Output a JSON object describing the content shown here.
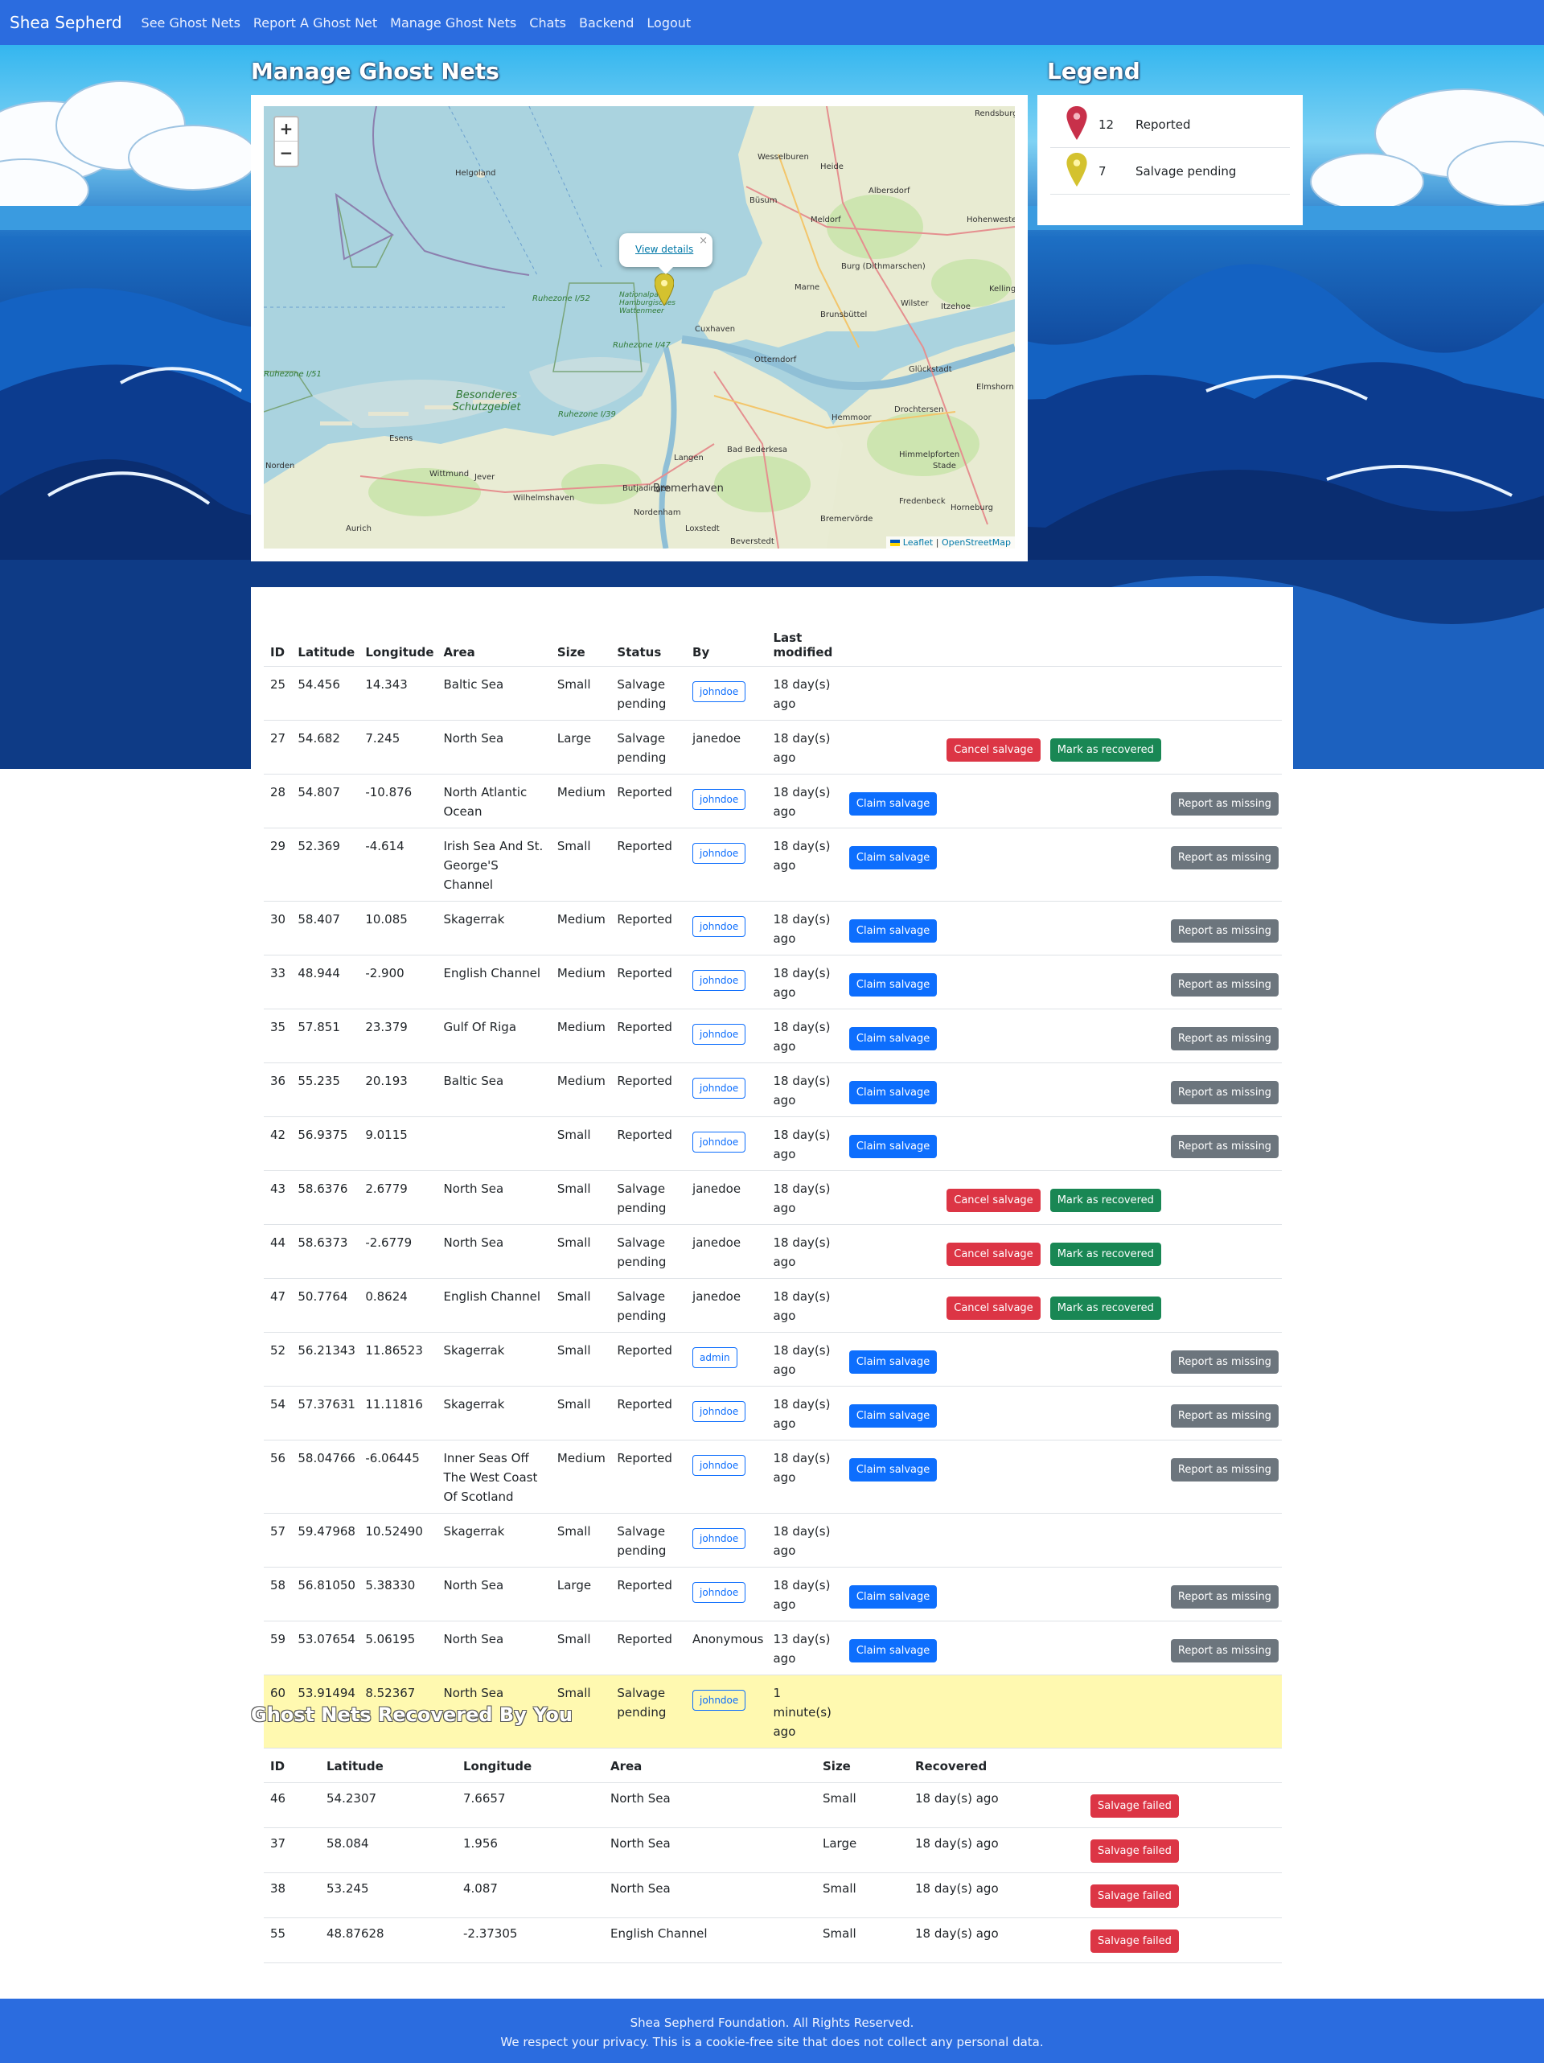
{
  "navbar": {
    "brand": "Shea Sepherd",
    "links": [
      "See Ghost Nets",
      "Report A Ghost Net",
      "Manage Ghost Nets",
      "Chats",
      "Backend",
      "Logout"
    ]
  },
  "page_title": "Manage Ghost Nets",
  "map": {
    "zoom_in": "+",
    "zoom_out": "−",
    "popup_link": "View details",
    "popup_close": "×",
    "attribution_leaflet": "Leaflet",
    "attribution_sep": "|",
    "attribution_osm": "OpenStreetMap",
    "labels": [
      "Helgoland",
      "Rendsburg",
      "Wesselburen",
      "Heide",
      "Büsum",
      "Albersdorf",
      "Meldorf",
      "Hohenwestedt",
      "Burg (Dithmarschen)",
      "Marne",
      "Wilster",
      "Itzehoe",
      "Kellinghusen",
      "Brunsbüttel",
      "Cuxhaven",
      "Otterndorf",
      "Glückstadt",
      "Elmshorn",
      "Besonderes Schutzgebiet",
      "Esens",
      "Wittmund",
      "Jever",
      "Norden",
      "Wilhelmshaven",
      "Butjadingen",
      "Langen",
      "Bad Bederkesa",
      "Hemmoor",
      "Drochtersen",
      "Himmelpforten",
      "Stade",
      "Bremerhaven",
      "Nordenham",
      "Loxstedt",
      "Beverstedt",
      "Bremervörde",
      "Fredenbeck",
      "Horneburg",
      "Aurich",
      "Ruhezone I/52",
      "Ruhezone I/47",
      "Ruhezone I/39",
      "Nationalpark Hamburgisches Wattenmeer",
      "Ruhezone I/51"
    ],
    "marker_color": "#d4c22f"
  },
  "legend": {
    "title": "Legend",
    "items": [
      {
        "count": "12",
        "label": "Reported",
        "color": "#c8304a"
      },
      {
        "count": "7",
        "label": "Salvage pending",
        "color": "#d4c22f"
      }
    ]
  },
  "nets_table": {
    "headers": [
      "ID",
      "Latitude",
      "Longitude",
      "Area",
      "Size",
      "Status",
      "By",
      "Last modified",
      "",
      "",
      "",
      ""
    ],
    "rows": [
      {
        "id": "25",
        "lat": "54.456",
        "lon": "14.343",
        "area": "Baltic Sea",
        "size": "Small",
        "status": "Salvage pending",
        "by": "johndoe",
        "by_pill": true,
        "modified": "18 day(s) ago",
        "claim": "",
        "cancel": "",
        "recovered": "",
        "missing": ""
      },
      {
        "id": "27",
        "lat": "54.682",
        "lon": "7.245",
        "area": "North Sea",
        "size": "Large",
        "status": "Salvage pending",
        "by": "janedoe",
        "by_pill": false,
        "modified": "18 day(s) ago",
        "claim": "",
        "cancel": "Cancel salvage",
        "recovered": "Mark as recovered",
        "missing": ""
      },
      {
        "id": "28",
        "lat": "54.807",
        "lon": "-10.876",
        "area": "North Atlantic Ocean",
        "size": "Medium",
        "status": "Reported",
        "by": "johndoe",
        "by_pill": true,
        "modified": "18 day(s) ago",
        "claim": "Claim salvage",
        "cancel": "",
        "recovered": "",
        "missing": "Report as missing"
      },
      {
        "id": "29",
        "lat": "52.369",
        "lon": "-4.614",
        "area": "Irish Sea And St. George'S Channel",
        "size": "Small",
        "status": "Reported",
        "by": "johndoe",
        "by_pill": true,
        "modified": "18 day(s) ago",
        "claim": "Claim salvage",
        "cancel": "",
        "recovered": "",
        "missing": "Report as missing"
      },
      {
        "id": "30",
        "lat": "58.407",
        "lon": "10.085",
        "area": "Skagerrak",
        "size": "Medium",
        "status": "Reported",
        "by": "johndoe",
        "by_pill": true,
        "modified": "18 day(s) ago",
        "claim": "Claim salvage",
        "cancel": "",
        "recovered": "",
        "missing": "Report as missing"
      },
      {
        "id": "33",
        "lat": "48.944",
        "lon": "-2.900",
        "area": "English Channel",
        "size": "Medium",
        "status": "Reported",
        "by": "johndoe",
        "by_pill": true,
        "modified": "18 day(s) ago",
        "claim": "Claim salvage",
        "cancel": "",
        "recovered": "",
        "missing": "Report as missing"
      },
      {
        "id": "35",
        "lat": "57.851",
        "lon": "23.379",
        "area": "Gulf Of Riga",
        "size": "Medium",
        "status": "Reported",
        "by": "johndoe",
        "by_pill": true,
        "modified": "18 day(s) ago",
        "claim": "Claim salvage",
        "cancel": "",
        "recovered": "",
        "missing": "Report as missing"
      },
      {
        "id": "36",
        "lat": "55.235",
        "lon": "20.193",
        "area": "Baltic Sea",
        "size": "Medium",
        "status": "Reported",
        "by": "johndoe",
        "by_pill": true,
        "modified": "18 day(s) ago",
        "claim": "Claim salvage",
        "cancel": "",
        "recovered": "",
        "missing": "Report as missing"
      },
      {
        "id": "42",
        "lat": "56.9375",
        "lon": "9.0115",
        "area": "",
        "size": "Small",
        "status": "Reported",
        "by": "johndoe",
        "by_pill": true,
        "modified": "18 day(s) ago",
        "claim": "Claim salvage",
        "cancel": "",
        "recovered": "",
        "missing": "Report as missing"
      },
      {
        "id": "43",
        "lat": "58.6376",
        "lon": "2.6779",
        "area": "North Sea",
        "size": "Small",
        "status": "Salvage pending",
        "by": "janedoe",
        "by_pill": false,
        "modified": "18 day(s) ago",
        "claim": "",
        "cancel": "Cancel salvage",
        "recovered": "Mark as recovered",
        "missing": ""
      },
      {
        "id": "44",
        "lat": "58.6373",
        "lon": "-2.6779",
        "area": "North Sea",
        "size": "Small",
        "status": "Salvage pending",
        "by": "janedoe",
        "by_pill": false,
        "modified": "18 day(s) ago",
        "claim": "",
        "cancel": "Cancel salvage",
        "recovered": "Mark as recovered",
        "missing": ""
      },
      {
        "id": "47",
        "lat": "50.7764",
        "lon": "0.8624",
        "area": "English Channel",
        "size": "Small",
        "status": "Salvage pending",
        "by": "janedoe",
        "by_pill": false,
        "modified": "18 day(s) ago",
        "claim": "",
        "cancel": "Cancel salvage",
        "recovered": "Mark as recovered",
        "missing": ""
      },
      {
        "id": "52",
        "lat": "56.21343",
        "lon": "11.86523",
        "area": "Skagerrak",
        "size": "Small",
        "status": "Reported",
        "by": "admin",
        "by_pill": true,
        "modified": "18 day(s) ago",
        "claim": "Claim salvage",
        "cancel": "",
        "recovered": "",
        "missing": "Report as missing"
      },
      {
        "id": "54",
        "lat": "57.37631",
        "lon": "11.11816",
        "area": "Skagerrak",
        "size": "Small",
        "status": "Reported",
        "by": "johndoe",
        "by_pill": true,
        "modified": "18 day(s) ago",
        "claim": "Claim salvage",
        "cancel": "",
        "recovered": "",
        "missing": "Report as missing"
      },
      {
        "id": "56",
        "lat": "58.04766",
        "lon": "-6.06445",
        "area": "Inner Seas Off The West Coast Of Scotland",
        "size": "Medium",
        "status": "Reported",
        "by": "johndoe",
        "by_pill": true,
        "modified": "18 day(s) ago",
        "claim": "Claim salvage",
        "cancel": "",
        "recovered": "",
        "missing": "Report as missing"
      },
      {
        "id": "57",
        "lat": "59.47968",
        "lon": "10.52490",
        "area": "Skagerrak",
        "size": "Small",
        "status": "Salvage pending",
        "by": "johndoe",
        "by_pill": true,
        "modified": "18 day(s) ago",
        "claim": "",
        "cancel": "",
        "recovered": "",
        "missing": ""
      },
      {
        "id": "58",
        "lat": "56.81050",
        "lon": "5.38330",
        "area": "North Sea",
        "size": "Large",
        "status": "Reported",
        "by": "johndoe",
        "by_pill": true,
        "modified": "18 day(s) ago",
        "claim": "Claim salvage",
        "cancel": "",
        "recovered": "",
        "missing": "Report as missing"
      },
      {
        "id": "59",
        "lat": "53.07654",
        "lon": "5.06195",
        "area": "North Sea",
        "size": "Small",
        "status": "Reported",
        "by": "Anonymous",
        "by_pill": false,
        "modified": "13 day(s) ago",
        "claim": "Claim salvage",
        "cancel": "",
        "recovered": "",
        "missing": "Report as missing"
      },
      {
        "id": "60",
        "lat": "53.91494",
        "lon": "8.52367",
        "area": "North Sea",
        "size": "Small",
        "status": "Salvage pending",
        "by": "johndoe",
        "by_pill": true,
        "modified": "1 minute(s) ago",
        "claim": "",
        "cancel": "",
        "recovered": "",
        "missing": "",
        "highlight": true
      }
    ]
  },
  "recovered": {
    "title": "Ghost Nets Recovered By You",
    "headers": [
      "ID",
      "Latitude",
      "Longitude",
      "Area",
      "Size",
      "Recovered",
      ""
    ],
    "rows": [
      {
        "id": "46",
        "lat": "54.2307",
        "lon": "7.6657",
        "area": "North Sea",
        "size": "Small",
        "recovered": "18 day(s) ago",
        "action": "Salvage failed"
      },
      {
        "id": "37",
        "lat": "58.084",
        "lon": "1.956",
        "area": "North Sea",
        "size": "Large",
        "recovered": "18 day(s) ago",
        "action": "Salvage failed"
      },
      {
        "id": "38",
        "lat": "53.245",
        "lon": "4.087",
        "area": "North Sea",
        "size": "Small",
        "recovered": "18 day(s) ago",
        "action": "Salvage failed"
      },
      {
        "id": "55",
        "lat": "48.87628",
        "lon": "-2.37305",
        "area": "English Channel",
        "size": "Small",
        "recovered": "18 day(s) ago",
        "action": "Salvage failed"
      }
    ]
  },
  "footer": {
    "line1": "Shea Sepherd Foundation. All Rights Reserved.",
    "line2": "We respect your privacy. This is a cookie-free site that does not collect any personal data."
  },
  "colors": {
    "navbar": "#2b6cdf",
    "primary": "#0d6efd",
    "danger": "#dc3545",
    "success": "#198754",
    "secondary": "#6c757d",
    "highlight_row": "#fff9b0"
  }
}
